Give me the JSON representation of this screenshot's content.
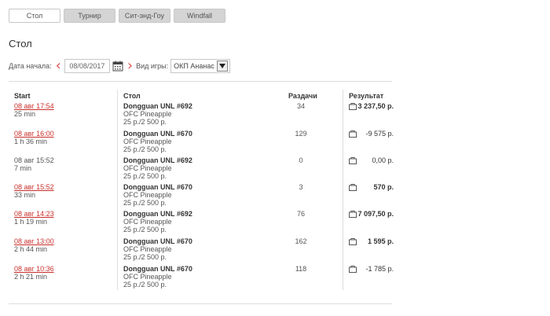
{
  "tabs": [
    {
      "label": "Стол",
      "active": true
    },
    {
      "label": "Турнир",
      "active": false
    },
    {
      "label": "Сит-энд-Гоу",
      "active": false
    },
    {
      "label": "Windfall",
      "active": false
    }
  ],
  "page_title": "Стол",
  "filter": {
    "date_label": "Дата начала:",
    "date_value": "08/08/2017",
    "game_label": "Вид игры:",
    "game_value": "ОКП Ананас"
  },
  "table": {
    "headers": {
      "start": "Start",
      "table": "Стол",
      "hands": "Раздачи",
      "result": "Результат"
    },
    "rows": [
      {
        "start": "08 авг 17:54",
        "linked": true,
        "duration": "25 min",
        "name": "Dongguan UNL #692",
        "game": "OFC Pineapple",
        "stakes": "25 р./2 500 р.",
        "hands": "34",
        "result": "3 237,50 р.",
        "result_bold": true
      },
      {
        "start": "08 авг 16:00",
        "linked": true,
        "duration": "1 h 36 min",
        "name": "Dongguan UNL #670",
        "game": "OFC Pineapple",
        "stakes": "25 р./2 500 р.",
        "hands": "129",
        "result": "-9 575 р.",
        "result_bold": false
      },
      {
        "start": "08 авг 15:52",
        "linked": false,
        "duration": "7 min",
        "name": "Dongguan UNL #692",
        "game": "OFC Pineapple",
        "stakes": "25 р./2 500 р.",
        "hands": "0",
        "result": "0,00 р.",
        "result_bold": false
      },
      {
        "start": "08 авг 15:52",
        "linked": true,
        "duration": "33 min",
        "name": "Dongguan UNL #670",
        "game": "OFC Pineapple",
        "stakes": "25 р./2 500 р.",
        "hands": "3",
        "result": "570 р.",
        "result_bold": true
      },
      {
        "start": "08 авг 14:23",
        "linked": true,
        "duration": "1 h 19 min",
        "name": "Dongguan UNL #692",
        "game": "OFC Pineapple",
        "stakes": "25 р./2 500 р.",
        "hands": "76",
        "result": "7 097,50 р.",
        "result_bold": true
      },
      {
        "start": "08 авг 13:00",
        "linked": true,
        "duration": "2 h 44 min",
        "name": "Dongguan UNL #670",
        "game": "OFC Pineapple",
        "stakes": "25 р./2 500 р.",
        "hands": "162",
        "result": "1 595 р.",
        "result_bold": true
      },
      {
        "start": "08 авг 10:36",
        "linked": true,
        "duration": "2 h 21 min",
        "name": "Dongguan UNL #670",
        "game": "OFC Pineapple",
        "stakes": "25 р./2 500 р.",
        "hands": "118",
        "result": "-1 785 р.",
        "result_bold": false
      }
    ]
  },
  "icons": {
    "prev": "chevron-left-icon",
    "next": "chevron-right-icon",
    "calendar": "calendar-icon",
    "dropdown": "dropdown-arrow-icon",
    "result": "replay-icon"
  },
  "colors": {
    "link": "#c9302c",
    "accent": "#d9534f"
  }
}
